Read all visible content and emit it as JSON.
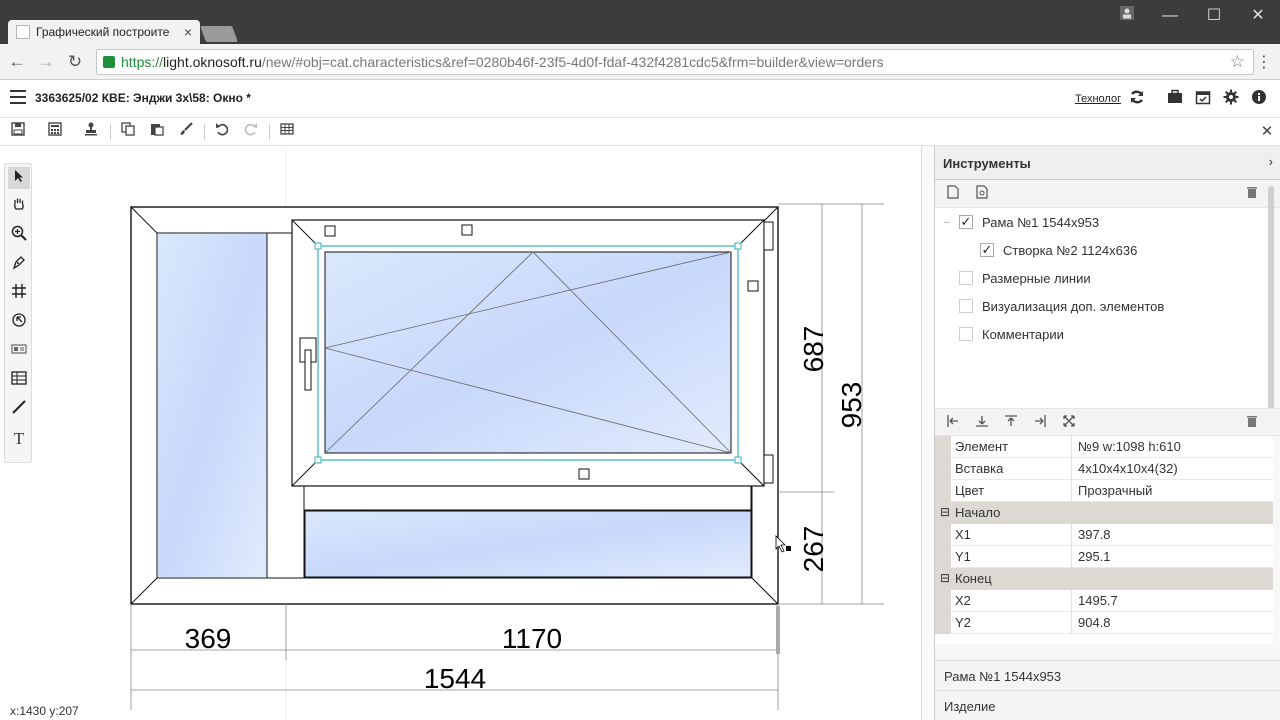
{
  "browser": {
    "tab_title": "Графический построите",
    "tab_close": "×",
    "url_prefix": "https://",
    "url_host": "light.oknosoft.ru",
    "url_path": "/new/#obj=cat.characteristics&ref=0280b46f-23f5-4d0f-fdaf-432f4281cdc5&frm=builder&view=orders",
    "win_min": "—",
    "win_max": "☐",
    "win_close": "✕",
    "nav_back": "←",
    "nav_forward": "→",
    "nav_reload": "↻",
    "star": "☆",
    "menu": "⋮"
  },
  "app": {
    "doc_title": "3363625/02 КВЕ: Энджи 3х\\58: Окно *",
    "role_link": "Технолог",
    "close_editor": "✕"
  },
  "right_panel": {
    "header": "Инструменты",
    "header_chevron": "›",
    "tree": [
      {
        "label": "Рама №1 1544х953",
        "checked": true
      },
      {
        "label": "Створка №2 1124х636",
        "checked": true
      },
      {
        "label": "Размерные линии",
        "checked": false
      },
      {
        "label": "Визуализация доп. элементов",
        "checked": false
      },
      {
        "label": "Комментарии",
        "checked": false
      }
    ],
    "props": {
      "element": {
        "key": "Элемент",
        "value": "№9 w:1098 h:610"
      },
      "insert": {
        "key": "Вставка",
        "value": "4x10x4x10x4(32)"
      },
      "color": {
        "key": "Цвет",
        "value": "Прозрачный"
      },
      "group_start": "Начало",
      "x1": {
        "key": "X1",
        "value": "397.8"
      },
      "y1": {
        "key": "Y1",
        "value": "295.1"
      },
      "group_end": "Конец",
      "x2": {
        "key": "X2",
        "value": "1495.7"
      },
      "y2": {
        "key": "Y2",
        "value": "904.8"
      },
      "collapse_mark": "⊟"
    },
    "section_frame": "Рама №1 1544х953",
    "section_product": "Изделие"
  },
  "drawing": {
    "dim_369": "369",
    "dim_1170": "1170",
    "dim_1544": "1544",
    "dim_687": "687",
    "dim_953": "953",
    "dim_267": "267"
  },
  "status": {
    "coords": "x:1430 y:207"
  }
}
